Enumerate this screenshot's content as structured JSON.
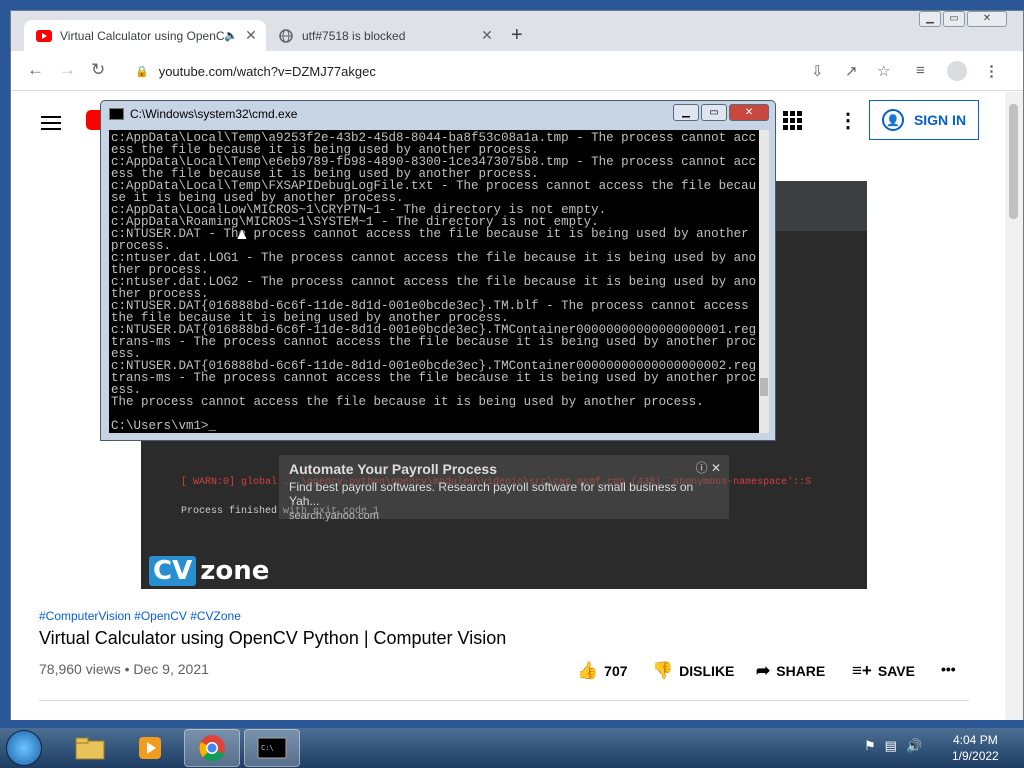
{
  "browser": {
    "tabs": [
      {
        "title": "Virtual Calculator using OpenCV Python | Computer Vision",
        "favicon": "youtube-icon",
        "active": true
      },
      {
        "title": "utf#7518 is blocked",
        "favicon": "globe-icon",
        "active": false
      }
    ],
    "url": "youtube.com/watch?v=DZMJ77akgec"
  },
  "youtube": {
    "sign_in": "SIGN IN",
    "hashtags": "#ComputerVision #OpenCV #CVZone",
    "title": "Virtual Calculator using OpenCV Python | Computer Vision",
    "meta": "78,960 views • Dec 9, 2021",
    "likes": "707",
    "dislike": "DISLIKE",
    "share": "SHARE",
    "save": "SAVE",
    "ad": {
      "title": "Automate Your Payroll Process",
      "desc": "Find best payroll softwares. Research payroll software for small business on Yah...",
      "url": "search.yahoo.com"
    },
    "video_console": {
      "warn_line": "[ WARN:0] global ...\\opencv-python\\opencv\\modules\\videoio\\src\\cap_msmf.cpp (438) `anonymous-namespace'::S",
      "finished": "Process finished with exit code 1"
    },
    "video_logo": {
      "cv": "CV",
      "zone": "zone"
    }
  },
  "cmd": {
    "title": "C:\\Windows\\system32\\cmd.exe",
    "output": "c:AppData\\Local\\Temp\\a9253f2e-43b2-45d8-8044-ba8f53c08a1a.tmp - The process cannot access the file because it is being used by another process.\nc:AppData\\Local\\Temp\\e6eb9789-fb98-4890-8300-1ce3473075b8.tmp - The process cannot access the file because it is being used by another process.\nc:AppData\\Local\\Temp\\FXSAPIDebugLogFile.txt - The process cannot access the file because it is being used by another process.\nc:AppData\\LocalLow\\MICROS~1\\CRYPTN~1 - The directory is not empty.\nc:AppData\\Roaming\\MICROS~1\\SYSTEM~1 - The directory is not empty.\nc:NTUSER.DAT - The process cannot access the file because it is being used by another process.\nc:ntuser.dat.LOG1 - The process cannot access the file because it is being used by another process.\nc:ntuser.dat.LOG2 - The process cannot access the file because it is being used by another process.\nc:NTUSER.DAT{016888bd-6c6f-11de-8d1d-001e0bcde3ec}.TM.blf - The process cannot access the file because it is being used by another process.\nc:NTUSER.DAT{016888bd-6c6f-11de-8d1d-001e0bcde3ec}.TMContainer00000000000000000001.regtrans-ms - The process cannot access the file because it is being used by another process.\nc:NTUSER.DAT{016888bd-6c6f-11de-8d1d-001e0bcde3ec}.TMContainer00000000000000000002.regtrans-ms - The process cannot access the file because it is being used by another process.\nThe process cannot access the file because it is being used by another process.\n\nC:\\Users\\vm1>_"
  },
  "taskbar": {
    "time": "4:04 PM",
    "date": "1/9/2022"
  }
}
